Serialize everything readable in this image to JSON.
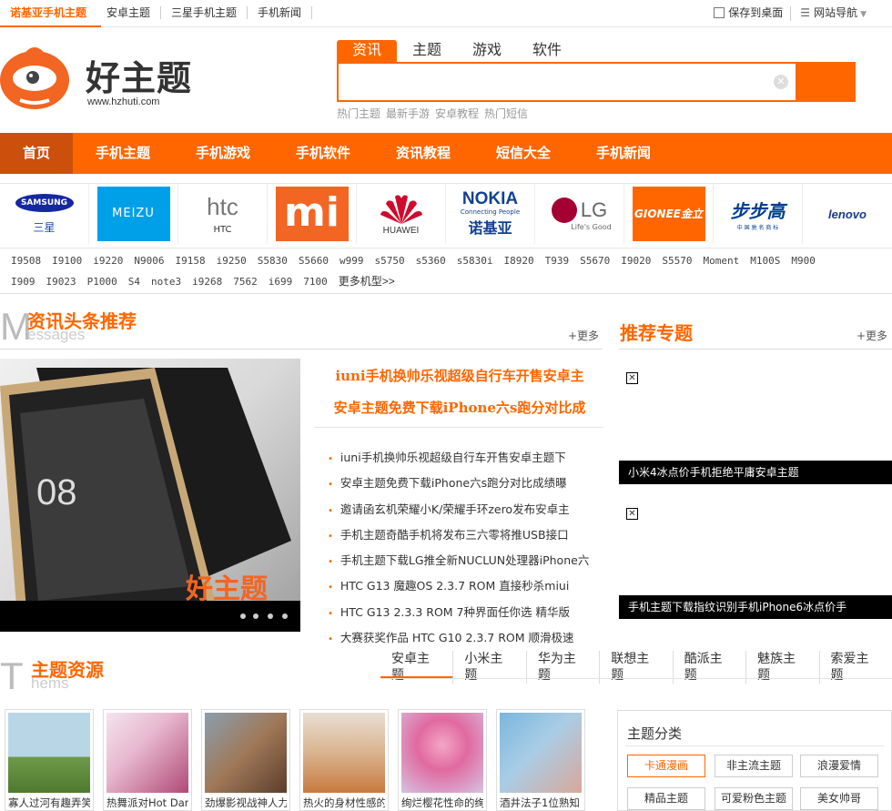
{
  "topbar": {
    "tabs": [
      "诺基亚手机主题",
      "安卓主题",
      "三星手机主题",
      "手机新闻"
    ],
    "save_desktop": "保存到桌面",
    "site_nav": "网站导航"
  },
  "logo": {
    "name": "好主题",
    "url": "www.hzhuti.com"
  },
  "search": {
    "tabs": [
      "资讯",
      "主题",
      "游戏",
      "软件"
    ],
    "value": "",
    "hot": [
      "热门主题",
      "最新手游",
      "安卓教程",
      "热门短信"
    ]
  },
  "nav": [
    "首页",
    "手机主题",
    "手机游戏",
    "手机软件",
    "资讯教程",
    "短信大全",
    "手机新闻"
  ],
  "brands": [
    {
      "logo": "SAMSUNG",
      "label": "三星",
      "color": "#1428a0"
    },
    {
      "logo": "MEIZU",
      "label": "",
      "color": "#00a0e9"
    },
    {
      "logo": "htc",
      "label": "HTC",
      "color": "#888888"
    },
    {
      "logo": "mi",
      "label": "",
      "color": "#f26522"
    },
    {
      "logo": "HUAWEI",
      "label": "",
      "color": "#cf0a2c"
    },
    {
      "logo": "NOKIA",
      "label": "诺基亚",
      "color": "#124191"
    },
    {
      "logo": "LG",
      "label": "",
      "color": "#a50034"
    },
    {
      "logo": "GIONEE金立",
      "label": "",
      "color": "#ff6600"
    },
    {
      "logo": "步步高",
      "label": "",
      "color": "#003e92"
    },
    {
      "logo": "lenovo",
      "label": "",
      "color": "#1b3a8c"
    }
  ],
  "models": {
    "row1": [
      "I9508",
      "I9100",
      "i9220",
      "N9006",
      "I9158",
      "i9250",
      "S5830",
      "S5660",
      "w999",
      "s5750",
      "s5360",
      "s5830i",
      "I8920",
      "T939",
      "S5670",
      "I9020",
      "S5570",
      "Moment",
      "M100S",
      "M900"
    ],
    "row2": [
      "I909",
      "I9023",
      "P1000",
      "S4",
      "note3",
      "i9268",
      "7562",
      "i699",
      "7100"
    ],
    "more": "更多机型>>"
  },
  "news_section": {
    "title": "资讯头条推荐",
    "letter": "M",
    "sub": "essages",
    "more": "+更多",
    "headlines": [
      "iuni手机换帅乐视超级自行车开售安卓主",
      "安卓主题免费下载iPhone六s跑分对比成"
    ],
    "items": [
      "iuni手机换帅乐视超级自行车开售安卓主题下",
      "安卓主题免费下载iPhone六s跑分对比成绩曝",
      "邀请函玄机荣耀小K/荣耀手环zero发布安卓主",
      "手机主题奇酷手机将发布三六零将推USB接口",
      "手机主题下载LG推全新NUCLUN处理器iPhone六",
      "HTC G13 魔趣OS 2.3.7 ROM 直接秒杀miui",
      "HTC G13 2.3.3 ROM 7种界面任你选 精华版",
      "大赛获奖作品 HTC G10 2.3.7 ROM 顺滑极速"
    ],
    "photo_text": "好主题"
  },
  "topic_section": {
    "title": "推荐专题",
    "more": "+更多",
    "captions": [
      "小米4冰点价手机拒绝平庸安卓主题",
      "手机主题下载指纹识别手机iPhone6冰点价手"
    ]
  },
  "theme_section": {
    "title": "主题资源",
    "letter": "T",
    "sub": "hems",
    "tabs": [
      "安卓主题",
      "小米主题",
      "华为主题",
      "联想主题",
      "酷派主题",
      "魅族主题",
      "索爱主题"
    ],
    "thumbs": [
      {
        "caption": "寡人过河有趣弄笑",
        "colors": [
          "#b9d6e6",
          "#6f9a4a"
        ]
      },
      {
        "caption": "热舞派对Hot Danc",
        "colors": [
          "#f4e4ee",
          "#b04a78"
        ]
      },
      {
        "caption": "劲爆影视战神人力",
        "colors": [
          "#8a9fb0",
          "#5b3d2c"
        ]
      },
      {
        "caption": "热火的身材性感的",
        "colors": [
          "#e8ded3",
          "#c87a3e"
        ]
      },
      {
        "caption": "绚烂樱花性命的绚",
        "colors": [
          "#d7c2e0",
          "#e06aa0"
        ]
      },
      {
        "caption": "酒井法子1位熟知",
        "colors": [
          "#7ab6dc",
          "#d9a89a"
        ]
      }
    ]
  },
  "category": {
    "title": "主题分类",
    "buttons": [
      "卡通漫画",
      "非主流主题",
      "浪漫爱情",
      "精品主题",
      "可爱粉色主题",
      "美女帅哥"
    ]
  }
}
